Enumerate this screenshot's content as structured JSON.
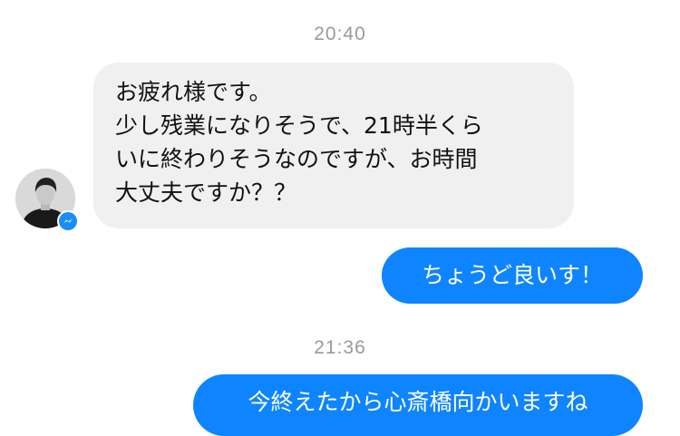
{
  "thread": {
    "timestamps": [
      "20:40",
      "21:36"
    ],
    "incoming": {
      "lines": [
        "お疲れ様です。",
        "少し残業になりそうで、21時半くら",
        "いに終わりそうなのですが、お時間",
        "大丈夫ですか？？"
      ]
    },
    "outgoing": [
      "ちょうど良いす！",
      "今終えたから心斎橋向かいますね"
    ]
  },
  "colors": {
    "outgoing_bubble": "#0f84ff",
    "incoming_bubble": "#f0f0f0",
    "timestamp": "#9a9a9e",
    "badge": "#1b8cf7"
  },
  "icons": {
    "avatar": "avatar",
    "badge": "messenger-badge-icon"
  }
}
